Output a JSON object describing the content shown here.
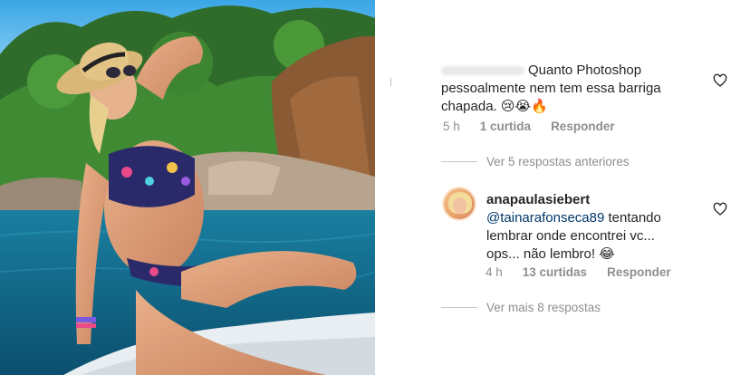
{
  "photo": {
    "description_icon": "beach-photo"
  },
  "comment1": {
    "line1": "Quanto Photoshop",
    "line2": "pessoalmente nem tem essa barriga",
    "line3": "chapada. 😢😭🔥",
    "time": "5 h",
    "likes": "1 curtida",
    "reply": "Responder"
  },
  "view_previous": "Ver 5 respostas anteriores",
  "reply": {
    "username": "anapaulasiebert",
    "mention": "@tainarafonseca89",
    "text1": " tentando",
    "text2": "lembrar onde encontrei vc...",
    "text3": "ops... não lembro! 😂",
    "time": "4 h",
    "likes": "13 curtidas",
    "reply": "Responder"
  },
  "view_more": "Ver mais 8 respostas",
  "colors": {
    "meta": "#8e8e8e",
    "mention": "#00376b",
    "text": "#262626"
  }
}
